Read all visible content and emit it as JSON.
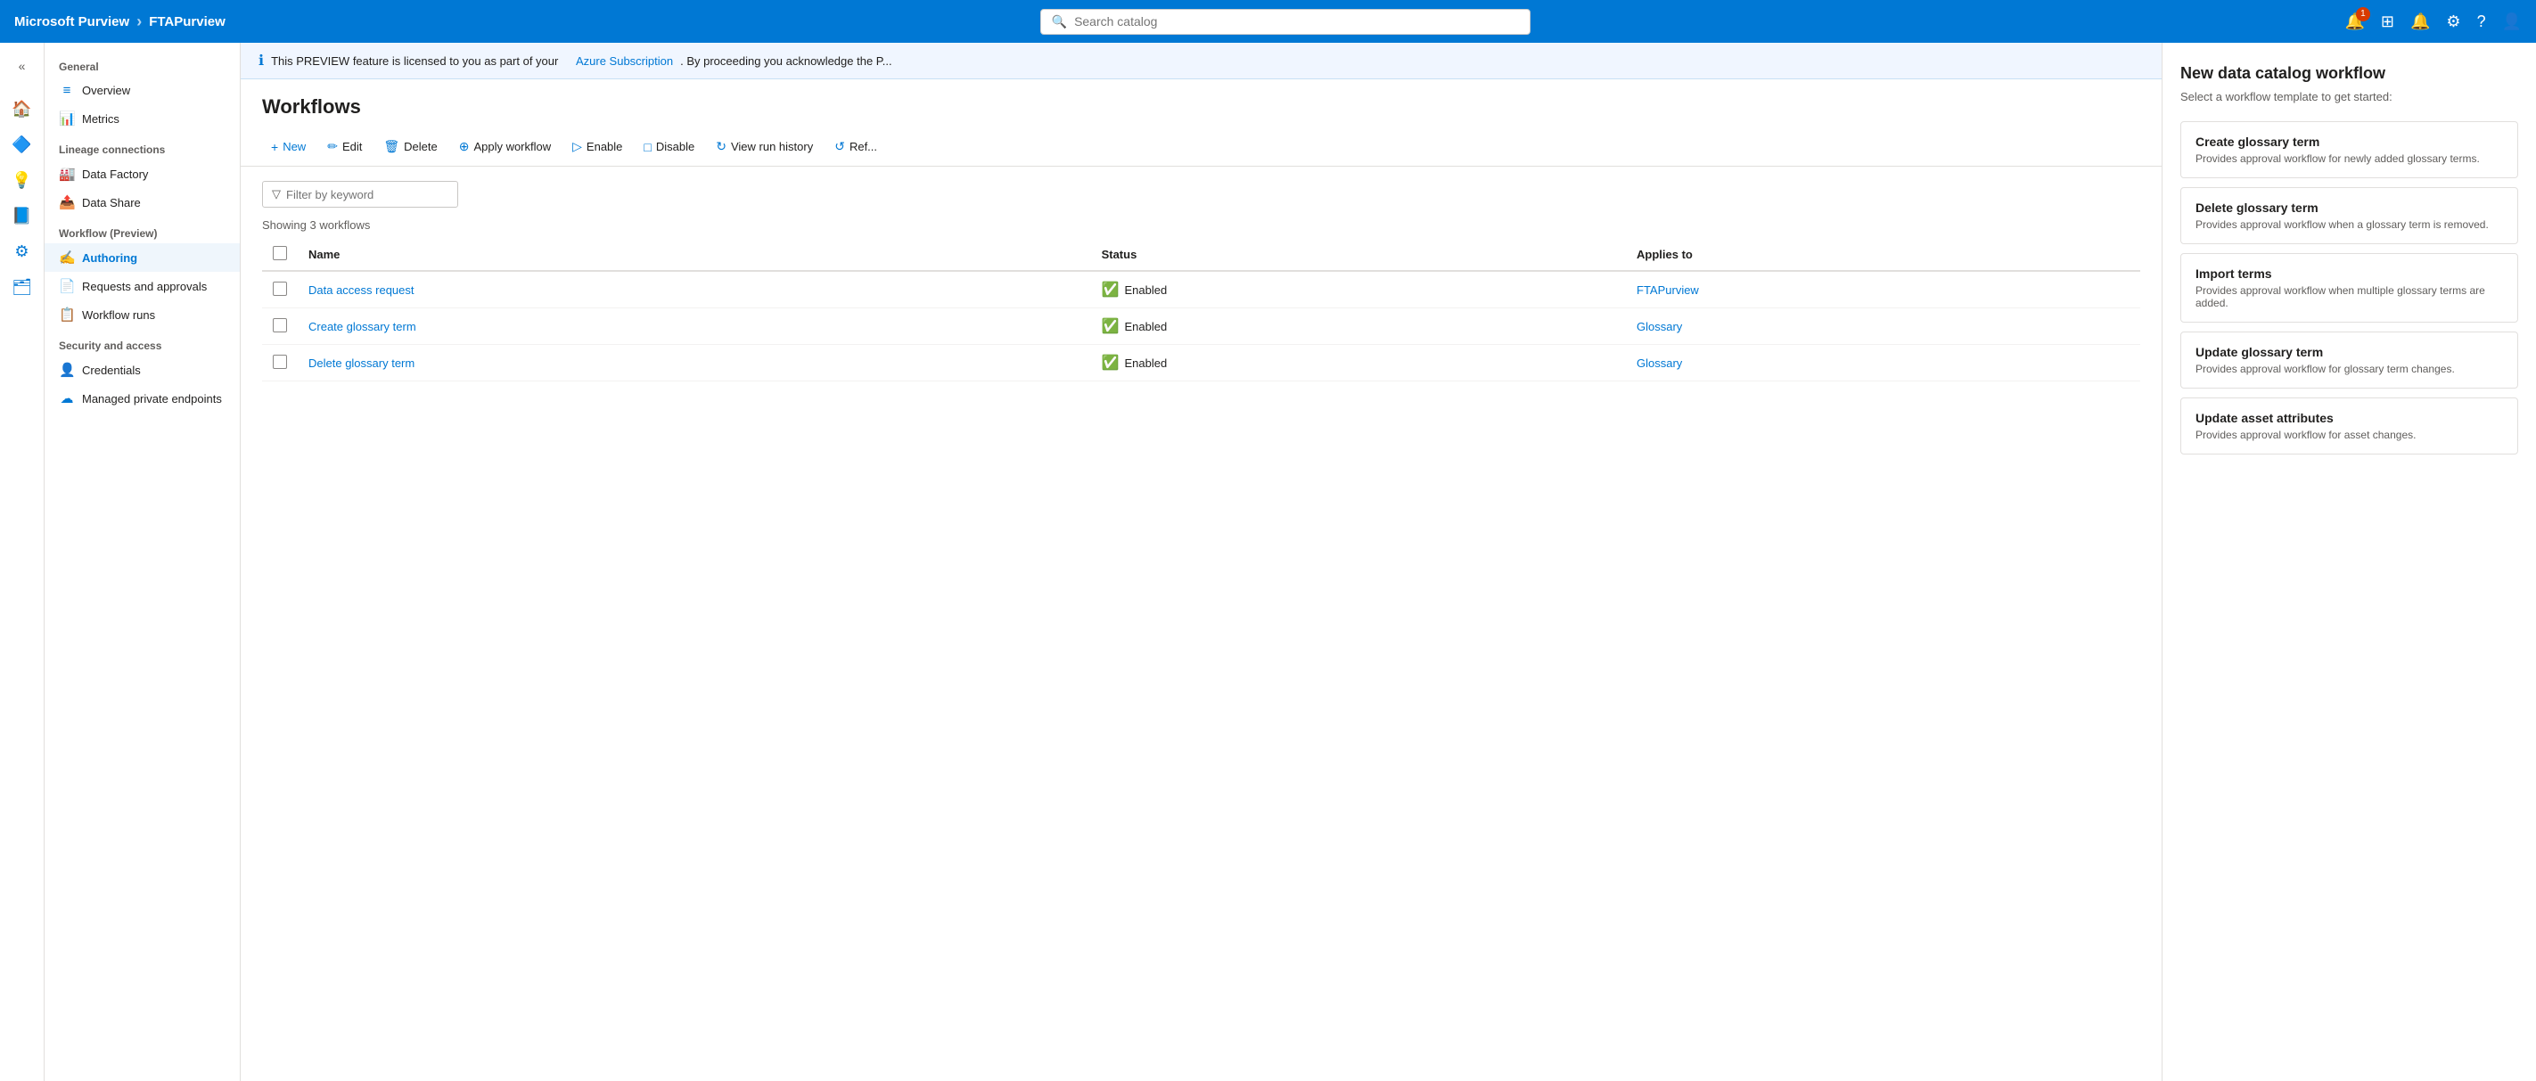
{
  "topNav": {
    "brand": "Microsoft Purview",
    "separator": "›",
    "instance": "FTAPurview",
    "searchPlaceholder": "Search catalog",
    "notificationCount": "1"
  },
  "infoBanner": {
    "text": "This PREVIEW feature is licensed to you as part of your",
    "linkText": "Azure Subscription",
    "linkSuffix": ". By proceeding you acknowledge the P..."
  },
  "sidebar": {
    "sections": [
      {
        "label": "General",
        "items": [
          {
            "icon": "≡",
            "label": "Overview"
          },
          {
            "icon": "📊",
            "label": "Metrics"
          }
        ]
      },
      {
        "label": "Lineage connections",
        "items": [
          {
            "icon": "🏭",
            "label": "Data Factory"
          },
          {
            "icon": "📤",
            "label": "Data Share"
          }
        ]
      },
      {
        "label": "Workflow (Preview)",
        "items": [
          {
            "icon": "✍",
            "label": "Authoring",
            "active": true
          },
          {
            "icon": "📄",
            "label": "Requests and approvals"
          },
          {
            "icon": "📋",
            "label": "Workflow runs"
          }
        ]
      },
      {
        "label": "Security and access",
        "items": [
          {
            "icon": "👤",
            "label": "Credentials"
          },
          {
            "icon": "☁",
            "label": "Managed private endpoints"
          }
        ]
      }
    ]
  },
  "page": {
    "title": "Workflows",
    "toolbar": {
      "buttons": [
        {
          "id": "new",
          "icon": "+",
          "label": "New",
          "primary": true
        },
        {
          "id": "edit",
          "icon": "✏",
          "label": "Edit"
        },
        {
          "id": "delete",
          "icon": "🗑",
          "label": "Delete"
        },
        {
          "id": "apply",
          "icon": "⊕",
          "label": "Apply workflow"
        },
        {
          "id": "enable",
          "icon": "▷",
          "label": "Enable"
        },
        {
          "id": "disable",
          "icon": "□",
          "label": "Disable"
        },
        {
          "id": "viewrun",
          "icon": "↻",
          "label": "View run history"
        },
        {
          "id": "refresh",
          "icon": "↺",
          "label": "Ref..."
        }
      ]
    },
    "filter": {
      "placeholder": "Filter by keyword"
    },
    "showingLabel": "Showing 3 workflows",
    "table": {
      "columns": [
        "Name",
        "Status",
        "Applies to"
      ],
      "rows": [
        {
          "name": "Data access request",
          "status": "Enabled",
          "appliesTo": "FTAPurview"
        },
        {
          "name": "Create glossary term",
          "status": "Enabled",
          "appliesTo": "Glossary"
        },
        {
          "name": "Delete glossary term",
          "status": "Enabled",
          "appliesTo": "Glossary"
        }
      ]
    }
  },
  "rightPanel": {
    "title": "New data catalog workflow",
    "subtitle": "Select a workflow template to get started:",
    "templates": [
      {
        "title": "Create glossary term",
        "desc": "Provides approval workflow for newly added glossary terms."
      },
      {
        "title": "Delete glossary term",
        "desc": "Provides approval workflow when a glossary term is removed."
      },
      {
        "title": "Import terms",
        "desc": "Provides approval workflow when multiple glossary terms are added."
      },
      {
        "title": "Update glossary term",
        "desc": "Provides approval workflow for glossary term changes."
      },
      {
        "title": "Update asset attributes",
        "desc": "Provides approval workflow for asset changes."
      }
    ]
  }
}
